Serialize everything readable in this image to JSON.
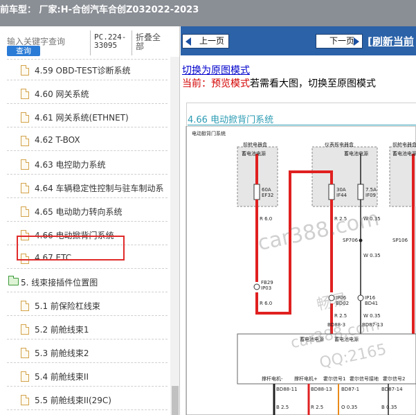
{
  "topbar": {
    "title": "前车型：  厂家:H-合创汽车合创Z032022-2023"
  },
  "sidebar": {
    "search_placeholder": "输入关键字查询",
    "search_button": "查询",
    "pc_code": "PC.224-33095",
    "collapse_all": "折叠全部",
    "items": [
      {
        "label": "4.59 OBD-TEST诊断系统",
        "kind": "doc"
      },
      {
        "label": "4.60 网关系统",
        "kind": "doc"
      },
      {
        "label": "4.61 网关系统(ETHNET)",
        "kind": "doc"
      },
      {
        "label": "4.62 T-BOX",
        "kind": "doc"
      },
      {
        "label": "4.63 电控助力系统",
        "kind": "doc"
      },
      {
        "label": "4.64 车辆稳定性控制与驻车制动系",
        "kind": "doc"
      },
      {
        "label": "4.65 电动助力转向系统",
        "kind": "doc"
      },
      {
        "label": "4.66 电动掀背门系统",
        "kind": "doc",
        "selected": true
      },
      {
        "label": "4.67 ETC",
        "kind": "doc"
      },
      {
        "label": "5. 线束接插件位置图",
        "kind": "folder"
      },
      {
        "label": "5.1 前保险杠线束",
        "kind": "doc"
      },
      {
        "label": "5.2 前舱线束1",
        "kind": "doc"
      },
      {
        "label": "5.3 前舱线束2",
        "kind": "doc"
      },
      {
        "label": "5.4 前舱线束II",
        "kind": "doc"
      },
      {
        "label": "5.5 前舱线束II(29C)",
        "kind": "doc"
      }
    ]
  },
  "toolbar": {
    "prev_label": "上一页",
    "next_label": "下一页",
    "refresh_label": "[刷新当前"
  },
  "content": {
    "switch_link": "切换为原图模式",
    "mode_current": "当前：预览模式",
    "mode_hint": "若需看大图，切换至原图模式",
    "section_title": "4.66 电动掀背门系统",
    "diagram": {
      "title": "电动掀背门系统",
      "box1_label": "前舱电器盒",
      "box2_label": "仪表板电器盒",
      "box3_label": "前舱电器盒",
      "sub1": "蓄电池电源",
      "sub2": "蓄电池电源",
      "sub3": "蓄电池电源",
      "fuse1": "60A EF32",
      "fuse2": "30A IF44",
      "fuse3": "7.5A IF09",
      "wire_r60": "R 6.0",
      "wire_r25a": "R 2.5",
      "wire_w035a": "W 0.35",
      "sp1": "SP706",
      "sp2": "SP106",
      "w035b": "W 0.35",
      "conn1": "FB29 IP03",
      "conn2": "IP06 BD02",
      "conn3": "IP16 BD41",
      "wire_r60b": "R 6.0",
      "wire_r25b": "R 2.5",
      "w035c": "W 0.35",
      "bd883": "BD88-3",
      "bd8713": "BD87-13",
      "module_power1": "蓄电池电源",
      "module_power2": "蓄电池电源",
      "pins": [
        "撑杆电机-",
        "撑杆电机+",
        "霍尔信号1",
        "霍尔信号接地",
        "霍尔信号2"
      ],
      "bottom_conns": [
        "BD88-11",
        "BD88-13",
        "BD87-1",
        "BD87-14"
      ],
      "bottom_wires": [
        "B 2.5",
        "R 2.5",
        "O 0.35",
        "B 0.35"
      ]
    }
  },
  "watermark": {
    "site": "car388.com",
    "brand": "畅易",
    "qq": "QQ:2165"
  },
  "colors": {
    "nav_blue": "#2b62a8",
    "wire_red": "#e02020",
    "select_red": "#e02a2a"
  }
}
